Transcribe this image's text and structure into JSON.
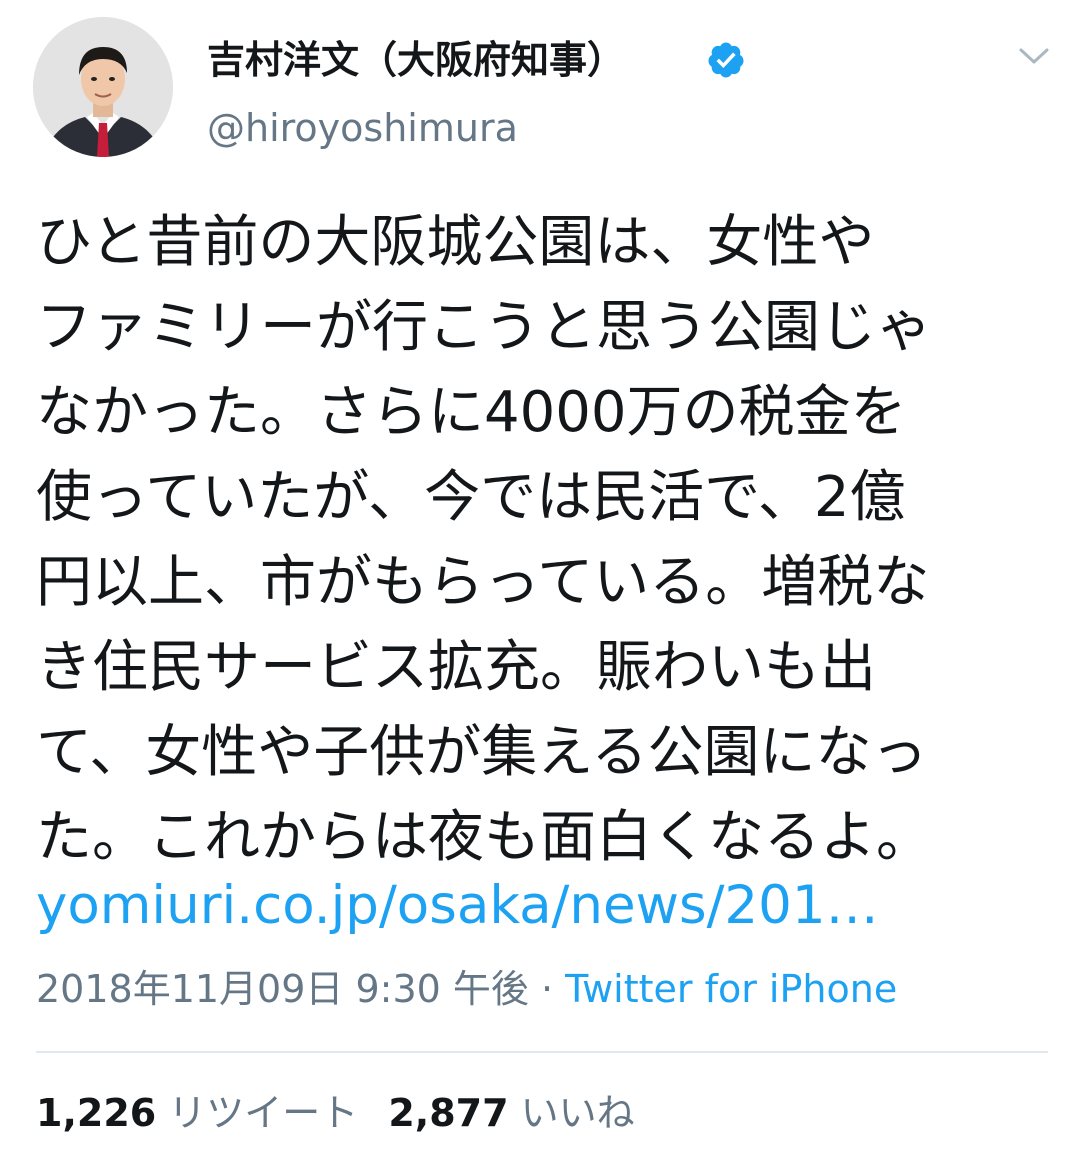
{
  "header": {
    "display_name": "吉村洋文（大阪府知事）",
    "handle": "@hiroyoshimura"
  },
  "icons": {
    "avatar": "profile-photo",
    "verified": "verified-badge-icon",
    "menu": "chevron-down-icon"
  },
  "tweet": {
    "lines": [
      "ひと昔前の大阪城公園は、女性や",
      "ファミリーが行こうと思う公園じゃ",
      "なかった。さらに4000万の税金を",
      "使っていたが、今では民活で、2億",
      "円以上、市がもらっている。増税な",
      "き住民サービス拡充。賑わいも出",
      "て、女性や子供が集える公園になっ",
      "た。これからは夜も面白くなるよ。"
    ],
    "link": "yomiuri.co.jp/osaka/news/201…"
  },
  "meta": {
    "timestamp": "2018年11月09日 9:30 午後",
    "separator": " · ",
    "source": "Twitter for iPhone"
  },
  "stats": {
    "retweets_count": "1,226",
    "retweets_label": "リツイート",
    "likes_count": "2,877",
    "likes_label": "いいね"
  },
  "colors": {
    "link": "#1da1f2",
    "secondary_text": "#657786",
    "primary_text": "#14171a",
    "divider": "#e1e8ed"
  }
}
